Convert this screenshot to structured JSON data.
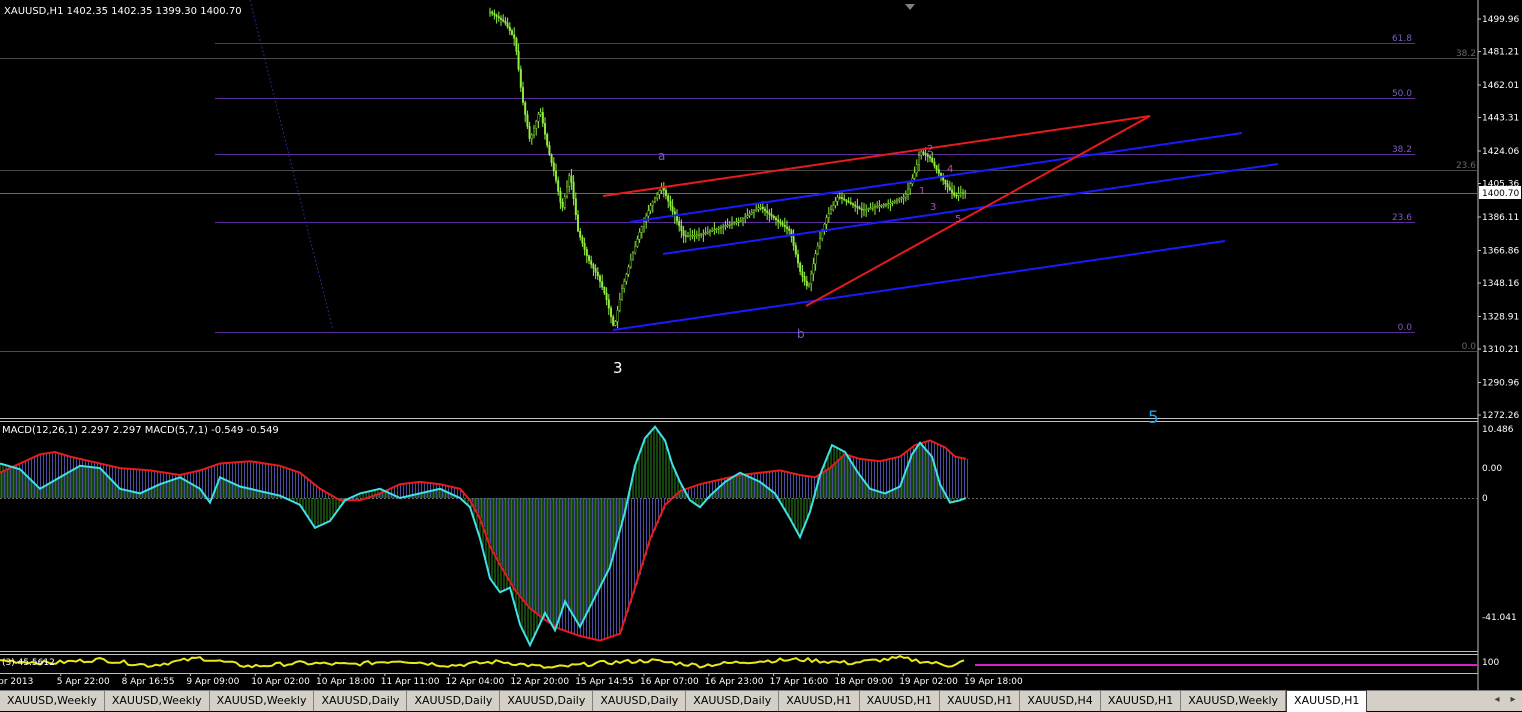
{
  "header": {
    "symbol_info": "XAUUSD,H1  1402.35 1402.35 1399.30 1400.70"
  },
  "current_price": "1400.70",
  "price_axis": [
    "1499.96",
    "1481.21",
    "1462.01",
    "1443.31",
    "1424.06",
    "1405.36",
    "1386.11",
    "1366.86",
    "1348.16",
    "1328.91",
    "1310.21",
    "1290.96",
    "1272.26"
  ],
  "time_axis": [
    "Apr 2013",
    "5 Apr 22:00",
    "8 Apr 16:55",
    "9 Apr 09:00",
    "10 Apr 02:00",
    "10 Apr 18:00",
    "11 Apr 11:00",
    "12 Apr 04:00",
    "12 Apr 20:00",
    "15 Apr 14:55",
    "16 Apr 07:00",
    "16 Apr 23:00",
    "17 Apr 16:00",
    "18 Apr 09:00",
    "19 Apr 02:00",
    "19 Apr 18:00"
  ],
  "fib_left": [
    "61.8",
    "50.0",
    "38.2",
    "23.6",
    "0.0"
  ],
  "fib_right": [
    "38.2",
    "23.6",
    "0.0"
  ],
  "waves": {
    "a": "a",
    "b": "b",
    "big3": "3",
    "big5": "5",
    "w1": "1",
    "w2": "2",
    "w3": "3",
    "w4": "4",
    "w5": "5"
  },
  "macd": {
    "label": "MACD(12,26,1) 2.297 2.297  MACD(5,7,1) -0.549 -0.549",
    "axis": [
      "10.486",
      "0.00",
      "0",
      "-41.041"
    ]
  },
  "sub": {
    "label": "(3) 45.5612",
    "axis": "100"
  },
  "tabs": [
    {
      "label": "XAUUSD,Weekly"
    },
    {
      "label": "XAUUSD,Weekly"
    },
    {
      "label": "XAUUSD,Weekly"
    },
    {
      "label": "XAUUSD,Daily"
    },
    {
      "label": "XAUUSD,Daily"
    },
    {
      "label": "XAUUSD,Daily"
    },
    {
      "label": "XAUUSD,Daily"
    },
    {
      "label": "XAUUSD,Daily"
    },
    {
      "label": "XAUUSD,H1"
    },
    {
      "label": "XAUUSD,H1"
    },
    {
      "label": "XAUUSD,H1"
    },
    {
      "label": "XAUUSD,H4"
    },
    {
      "label": "XAUUSD,H1"
    },
    {
      "label": "XAUUSD,Weekly"
    },
    {
      "label": "XAUUSD,H1",
      "active": true
    }
  ],
  "chart_data": {
    "type": "line",
    "title": "XAUUSD,H1",
    "ylim": [
      1265,
      1508
    ],
    "x": [
      "Apr 2013",
      "5 Apr 22:00",
      "8 Apr 16:55",
      "9 Apr 09:00",
      "10 Apr 02:00",
      "10 Apr 18:00",
      "11 Apr 11:00",
      "12 Apr 04:00",
      "12 Apr 20:00",
      "15 Apr 14:55",
      "16 Apr 07:00",
      "16 Apr 23:00",
      "17 Apr 16:00",
      "18 Apr 09:00",
      "19 Apr 02:00",
      "19 Apr 18:00"
    ],
    "price_anchors": [
      [
        490,
        1504
      ],
      [
        505,
        1498
      ],
      [
        515,
        1488
      ],
      [
        522,
        1455
      ],
      [
        530,
        1430
      ],
      [
        540,
        1448
      ],
      [
        548,
        1425
      ],
      [
        555,
        1410
      ],
      [
        562,
        1390
      ],
      [
        570,
        1412
      ],
      [
        578,
        1378
      ],
      [
        588,
        1362
      ],
      [
        598,
        1352
      ],
      [
        606,
        1340
      ],
      [
        614,
        1322
      ],
      [
        622,
        1345
      ],
      [
        630,
        1360
      ],
      [
        640,
        1378
      ],
      [
        650,
        1392
      ],
      [
        662,
        1404
      ],
      [
        672,
        1390
      ],
      [
        684,
        1375
      ],
      [
        700,
        1376
      ],
      [
        720,
        1380
      ],
      [
        740,
        1384
      ],
      [
        760,
        1392
      ],
      [
        775,
        1385
      ],
      [
        790,
        1378
      ],
      [
        800,
        1355
      ],
      [
        808,
        1345
      ],
      [
        816,
        1366
      ],
      [
        826,
        1385
      ],
      [
        838,
        1398
      ],
      [
        850,
        1394
      ],
      [
        862,
        1390
      ],
      [
        875,
        1392
      ],
      [
        890,
        1394
      ],
      [
        905,
        1398
      ],
      [
        915,
        1412
      ],
      [
        920,
        1424
      ],
      [
        930,
        1420
      ],
      [
        940,
        1410
      ],
      [
        948,
        1403
      ],
      [
        955,
        1398
      ],
      [
        960,
        1400
      ],
      [
        967,
        1400.7
      ]
    ],
    "macd_fast": [
      [
        0,
        30
      ],
      [
        20,
        25
      ],
      [
        40,
        8
      ],
      [
        60,
        18
      ],
      [
        80,
        28
      ],
      [
        100,
        26
      ],
      [
        120,
        8
      ],
      [
        140,
        4
      ],
      [
        160,
        12
      ],
      [
        180,
        18
      ],
      [
        200,
        8
      ],
      [
        210,
        -4
      ],
      [
        220,
        18
      ],
      [
        240,
        10
      ],
      [
        260,
        6
      ],
      [
        280,
        2
      ],
      [
        300,
        -6
      ],
      [
        315,
        -26
      ],
      [
        330,
        -20
      ],
      [
        345,
        -2
      ],
      [
        360,
        4
      ],
      [
        380,
        8
      ],
      [
        400,
        0
      ],
      [
        420,
        4
      ],
      [
        440,
        8
      ],
      [
        460,
        0
      ],
      [
        470,
        -8
      ],
      [
        480,
        -35
      ],
      [
        490,
        -70
      ],
      [
        500,
        -82
      ],
      [
        510,
        -78
      ],
      [
        520,
        -110
      ],
      [
        530,
        -128
      ],
      [
        545,
        -100
      ],
      [
        555,
        -115
      ],
      [
        565,
        -90
      ],
      [
        580,
        -112
      ],
      [
        595,
        -86
      ],
      [
        610,
        -60
      ],
      [
        625,
        -12
      ],
      [
        635,
        28
      ],
      [
        645,
        52
      ],
      [
        655,
        62
      ],
      [
        665,
        50
      ],
      [
        672,
        30
      ],
      [
        680,
        14
      ],
      [
        690,
        -2
      ],
      [
        700,
        -8
      ],
      [
        710,
        2
      ],
      [
        725,
        14
      ],
      [
        740,
        22
      ],
      [
        760,
        14
      ],
      [
        775,
        4
      ],
      [
        790,
        -18
      ],
      [
        800,
        -34
      ],
      [
        810,
        -12
      ],
      [
        820,
        20
      ],
      [
        832,
        46
      ],
      [
        845,
        40
      ],
      [
        858,
        22
      ],
      [
        870,
        8
      ],
      [
        885,
        4
      ],
      [
        900,
        10
      ],
      [
        912,
        38
      ],
      [
        920,
        48
      ],
      [
        932,
        36
      ],
      [
        940,
        12
      ],
      [
        950,
        -4
      ],
      [
        960,
        -2
      ],
      [
        966,
        0
      ]
    ],
    "macd_slow": [
      [
        0,
        22
      ],
      [
        20,
        30
      ],
      [
        40,
        38
      ],
      [
        55,
        40
      ],
      [
        70,
        36
      ],
      [
        90,
        32
      ],
      [
        120,
        26
      ],
      [
        150,
        24
      ],
      [
        180,
        20
      ],
      [
        200,
        24
      ],
      [
        220,
        30
      ],
      [
        250,
        32
      ],
      [
        280,
        28
      ],
      [
        300,
        22
      ],
      [
        320,
        8
      ],
      [
        340,
        -2
      ],
      [
        360,
        -2
      ],
      [
        380,
        4
      ],
      [
        400,
        12
      ],
      [
        420,
        14
      ],
      [
        440,
        12
      ],
      [
        460,
        8
      ],
      [
        470,
        -2
      ],
      [
        480,
        -18
      ],
      [
        490,
        -42
      ],
      [
        500,
        -58
      ],
      [
        515,
        -80
      ],
      [
        530,
        -96
      ],
      [
        545,
        -106
      ],
      [
        560,
        -114
      ],
      [
        580,
        -120
      ],
      [
        600,
        -124
      ],
      [
        620,
        -118
      ],
      [
        635,
        -78
      ],
      [
        650,
        -36
      ],
      [
        665,
        -6
      ],
      [
        680,
        6
      ],
      [
        700,
        12
      ],
      [
        720,
        16
      ],
      [
        740,
        20
      ],
      [
        760,
        22
      ],
      [
        780,
        24
      ],
      [
        800,
        20
      ],
      [
        815,
        18
      ],
      [
        830,
        26
      ],
      [
        845,
        38
      ],
      [
        860,
        34
      ],
      [
        880,
        32
      ],
      [
        900,
        36
      ],
      [
        915,
        46
      ],
      [
        930,
        50
      ],
      [
        945,
        44
      ],
      [
        955,
        36
      ],
      [
        966,
        34
      ]
    ],
    "sub_series": [
      [
        0,
        60
      ],
      [
        50,
        55
      ],
      [
        100,
        62
      ],
      [
        150,
        50
      ],
      [
        200,
        65
      ],
      [
        250,
        48
      ],
      [
        300,
        55
      ],
      [
        350,
        52
      ],
      [
        400,
        60
      ],
      [
        450,
        50
      ],
      [
        500,
        58
      ],
      [
        550,
        45
      ],
      [
        600,
        55
      ],
      [
        650,
        60
      ],
      [
        700,
        50
      ],
      [
        750,
        58
      ],
      [
        800,
        62
      ],
      [
        850,
        55
      ],
      [
        900,
        65
      ],
      [
        950,
        50
      ],
      [
        966,
        60
      ]
    ]
  }
}
